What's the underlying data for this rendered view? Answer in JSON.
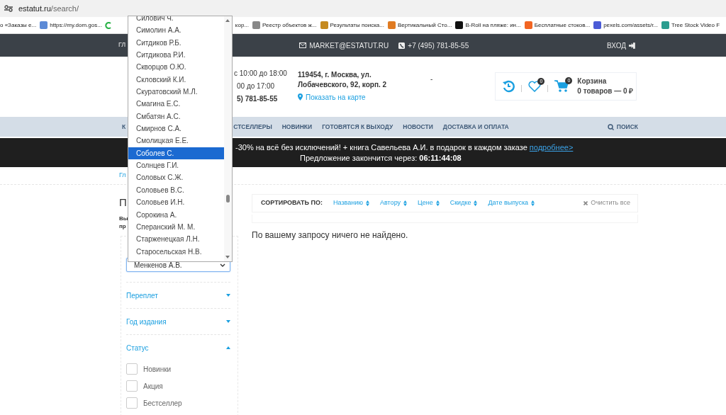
{
  "browser": {
    "url_host": "estatut.ru",
    "url_path": "/search/",
    "bookmarks": [
      {
        "label": "о «Заказы е..."
      },
      {
        "label": "https://my.dom.gos..."
      },
      {
        "label": "кор..."
      },
      {
        "label": "Реестр объектов ж..."
      },
      {
        "label": "Результаты поиска..."
      },
      {
        "label": "Вертикальный Сто..."
      },
      {
        "label": "B-Roll на пляже: ин..."
      },
      {
        "label": "Бесплатные стоков..."
      },
      {
        "label": "pexels.com/assets/r..."
      },
      {
        "label": "Tree Stock Video F"
      }
    ]
  },
  "topbar": {
    "menu_fragment": "ГЛ",
    "email": "MARKET@ESTATUT.RU",
    "phone": "+7 (495) 781-85-55",
    "login": "ВХОД"
  },
  "info": {
    "hours": [
      "с 10:00 до 18:00",
      "00 до 17:00"
    ],
    "phone_fragment": "5) 781-85-55",
    "address": "119454, г. Москва, ул. Лобачевского, 92, корп. 2",
    "map_link": "Показать на карте",
    "dash": "-",
    "wishlist_count": "0",
    "cart_count": "0",
    "cart_title": "Корзина",
    "cart_summary": "0 товаров — 0 ₽"
  },
  "nav": {
    "items": [
      "К",
      "СТСЕЛЛЕРЫ",
      "НОВИНКИ",
      "ГОТОВЯТСЯ К ВЫХОДУ",
      "НОВОСТИ",
      "ДОСТАВКА И ОПЛАТА"
    ],
    "search": "ПОИСК"
  },
  "promo": {
    "line1": "-30% на всё без исключений! + книга Савельева А.И. в подарок в каждом заказе",
    "link": "подробнее>",
    "line2": "Предложение закончится через: **06:11:44:08**"
  },
  "breadcrumb": "Гл",
  "sidebar": {
    "heading": "П",
    "subheading": [
      "Вы",
      "пр"
    ],
    "author_select": "Менкенов А.В.",
    "filters": [
      {
        "label": "Переплет",
        "expanded": false
      },
      {
        "label": "Год издания",
        "expanded": false
      },
      {
        "label": "Статус",
        "expanded": true
      }
    ],
    "status_options": [
      {
        "label": "Новинки",
        "checked": false
      },
      {
        "label": "Акция",
        "checked": false
      },
      {
        "label": "Бестселлер",
        "checked": false
      }
    ]
  },
  "sort": {
    "label": "СОРТИРОВАТЬ ПО:",
    "options": [
      "Названию",
      "Автору",
      "Цене",
      "Скидке",
      "Дате выпуска"
    ],
    "clear": "Очистить все"
  },
  "empty_message": "По вашему запросу ничего не найдено.",
  "dropdown": {
    "items": [
      {
        "label": "Силович Ч.",
        "selected": false
      },
      {
        "label": "Симолин А.А.",
        "selected": false
      },
      {
        "label": "Ситдиков Р.Б.",
        "selected": false
      },
      {
        "label": "Ситдикова Р.И.",
        "selected": false
      },
      {
        "label": "Скворцов О.Ю.",
        "selected": false
      },
      {
        "label": "Скловский К.И.",
        "selected": false
      },
      {
        "label": "Скуратовский М.Л.",
        "selected": false
      },
      {
        "label": "Смагина Е.С.",
        "selected": false
      },
      {
        "label": "Смбатян А.С.",
        "selected": false
      },
      {
        "label": "Смирнов С.А.",
        "selected": false
      },
      {
        "label": "Смолицкая Е.Е.",
        "selected": false
      },
      {
        "label": "Соболев С.",
        "selected": true
      },
      {
        "label": "Солнцев Г.И.",
        "selected": false
      },
      {
        "label": "Соловых С.Ж.",
        "selected": false
      },
      {
        "label": "Соловьев В.С.",
        "selected": false
      },
      {
        "label": "Соловьев И.Н.",
        "selected": false
      },
      {
        "label": "Сорокина А.",
        "selected": false
      },
      {
        "label": "Сперанский М. М.",
        "selected": false
      },
      {
        "label": "Старженецкая Л.Н.",
        "selected": false
      },
      {
        "label": "Старосельская Н.В.",
        "selected": false
      }
    ]
  }
}
